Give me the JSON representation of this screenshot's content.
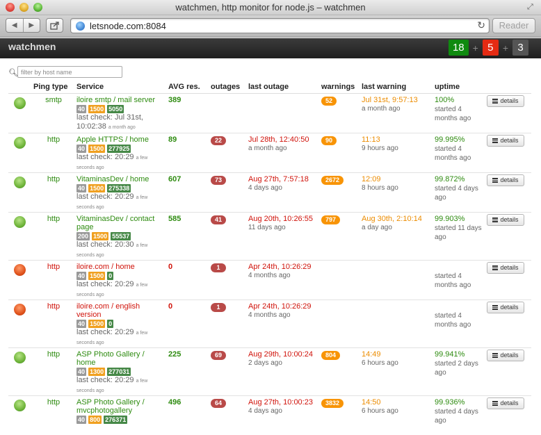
{
  "window": {
    "title": "watchmen, http monitor for node.js – watchmen"
  },
  "browser": {
    "url": "letsnode.com:8084",
    "reader_label": "Reader",
    "back": "◀",
    "forward": "▶",
    "reload": "↻"
  },
  "app": {
    "brand": "watchmen",
    "counters": {
      "up": "18",
      "down": "5",
      "paused": "3",
      "plus": "+"
    }
  },
  "filter": {
    "placeholder": "filter by host name",
    "value": ""
  },
  "table": {
    "headers": {
      "ping_type": "Ping type",
      "service": "Service",
      "avg": "AVG res.",
      "outages": "outages",
      "last_outage": "last outage",
      "warnings": "warnings",
      "last_warning": "last warning",
      "uptime": "uptime"
    },
    "details_label": "details",
    "rows": [
      {
        "status": "ok",
        "ping": "smtp",
        "service": "iloire smtp / mail server",
        "tags": [
          "40",
          "1500",
          "5050"
        ],
        "lastcheck": "last check: Jul 31st, 10:02:38",
        "ago": "a month ago",
        "avg": "389",
        "outages": "",
        "last_outage": "",
        "last_outage_ago": "",
        "warnings": "52",
        "last_warning": "Jul 31st, 9:57:13",
        "last_warning_ago": "a month ago",
        "uptime": "100%",
        "started": "started 4 months ago"
      },
      {
        "status": "ok",
        "ping": "http",
        "service": "Apple HTTPS / home",
        "tags": [
          "40",
          "1500",
          "277925"
        ],
        "lastcheck": "last check: 20:29",
        "ago": "a few seconds ago",
        "avg": "89",
        "outages": "22",
        "last_outage": "Jul 28th, 12:40:50",
        "last_outage_ago": "a month ago",
        "warnings": "90",
        "last_warning": "11:13",
        "last_warning_ago": "9 hours ago",
        "uptime": "99.995%",
        "started": "started 4 months ago"
      },
      {
        "status": "ok",
        "ping": "http",
        "service": "VitaminasDev / home",
        "tags": [
          "40",
          "1500",
          "275338"
        ],
        "lastcheck": "last check: 20:29",
        "ago": "a few seconds ago",
        "avg": "607",
        "outages": "73",
        "last_outage": "Aug 27th, 7:57:18",
        "last_outage_ago": "4 days ago",
        "warnings": "2672",
        "last_warning": "12:09",
        "last_warning_ago": "8 hours ago",
        "uptime": "99.872%",
        "started": "started 4 days ago"
      },
      {
        "status": "ok",
        "ping": "http",
        "service": "VitaminasDev / contact page",
        "tags": [
          "200",
          "1500",
          "55537"
        ],
        "lastcheck": "last check: 20:30",
        "ago": "a few seconds ago",
        "avg": "585",
        "outages": "41",
        "last_outage": "Aug 20th, 10:26:55",
        "last_outage_ago": "11 days ago",
        "warnings": "797",
        "last_warning": "Aug 30th, 2:10:14",
        "last_warning_ago": "a day ago",
        "uptime": "99.903%",
        "started": "started 11 days ago"
      },
      {
        "status": "fail",
        "ping": "http",
        "service": "iloire.com / home",
        "tags": [
          "40",
          "1500",
          "0"
        ],
        "lastcheck": "last check: 20:29",
        "ago": "a few seconds ago",
        "avg": "0",
        "outages": "1",
        "last_outage": "Apr 24th, 10:26:29",
        "last_outage_ago": "4 months ago",
        "warnings": "",
        "last_warning": "",
        "last_warning_ago": "",
        "uptime": "",
        "started": "started 4 months ago"
      },
      {
        "status": "fail",
        "ping": "http",
        "service": "iloire.com / english version",
        "tags": [
          "40",
          "1500",
          "0"
        ],
        "lastcheck": "last check: 20:29",
        "ago": "a few seconds ago",
        "avg": "0",
        "outages": "1",
        "last_outage": "Apr 24th, 10:26:29",
        "last_outage_ago": "4 months ago",
        "warnings": "",
        "last_warning": "",
        "last_warning_ago": "",
        "uptime": "",
        "started": "started 4 months ago"
      },
      {
        "status": "ok",
        "ping": "http",
        "service": "ASP Photo Gallery / home",
        "tags": [
          "40",
          "1300",
          "277031"
        ],
        "lastcheck": "last check: 20:29",
        "ago": "a few seconds ago",
        "avg": "225",
        "outages": "69",
        "last_outage": "Aug 29th, 10:00:24",
        "last_outage_ago": "2 days ago",
        "warnings": "804",
        "last_warning": "14:49",
        "last_warning_ago": "6 hours ago",
        "uptime": "99.941%",
        "started": "started 2 days ago"
      },
      {
        "status": "ok",
        "ping": "http",
        "service": "ASP Photo Gallery / mvcphotogallery",
        "tags": [
          "40",
          "800",
          "276371"
        ],
        "lastcheck": "",
        "ago": "",
        "avg": "496",
        "outages": "64",
        "last_outage": "Aug 27th, 10:00:23",
        "last_outage_ago": "4 days ago",
        "warnings": "3832",
        "last_warning": "14:50",
        "last_warning_ago": "6 hours ago",
        "uptime": "99.936%",
        "started": "started 4 days ago"
      }
    ]
  },
  "colors": {
    "ok": "#6fb43a",
    "fail": "#e0531c",
    "up_counter": "#0f8a0f",
    "down_counter": "#e52b13",
    "paused_counter": "#555555"
  }
}
